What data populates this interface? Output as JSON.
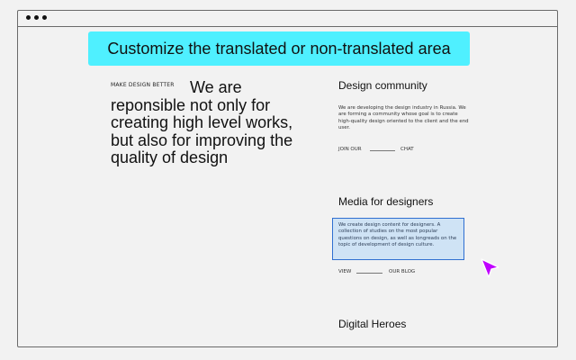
{
  "banner": {
    "text": "Customize the translated or non-translated area"
  },
  "hero": {
    "eyebrow": "MAKE DESIGN BETTER",
    "line1": "We are",
    "rest": "reponsible not only for creating high level works, but also for improving the quality of design"
  },
  "sections": [
    {
      "title": "Design community",
      "description": "We are developing the design industry in Russia. We are forming a community whose goal is to create high-quality design oriented to the client and the end user.",
      "link_left": "JOIN OUR",
      "link_right": "CHAT"
    },
    {
      "title": "Media for designers",
      "description": "We create design content for designers. A collection of studies on the most popular questions on design, as well as longreads on the topic of development of design culture.",
      "link_left": "VIEW",
      "link_right": "OUR BLOG"
    },
    {
      "title": "Digital Heroes"
    }
  ],
  "colors": {
    "banner_bg": "#4ff0ff",
    "highlight_bg": "#cfe3f5",
    "highlight_border": "#2f6fd1",
    "cursor": "#c000ff"
  },
  "icons": {
    "window_dots": "window-control-dots",
    "cursor": "pointer-cursor-icon"
  }
}
